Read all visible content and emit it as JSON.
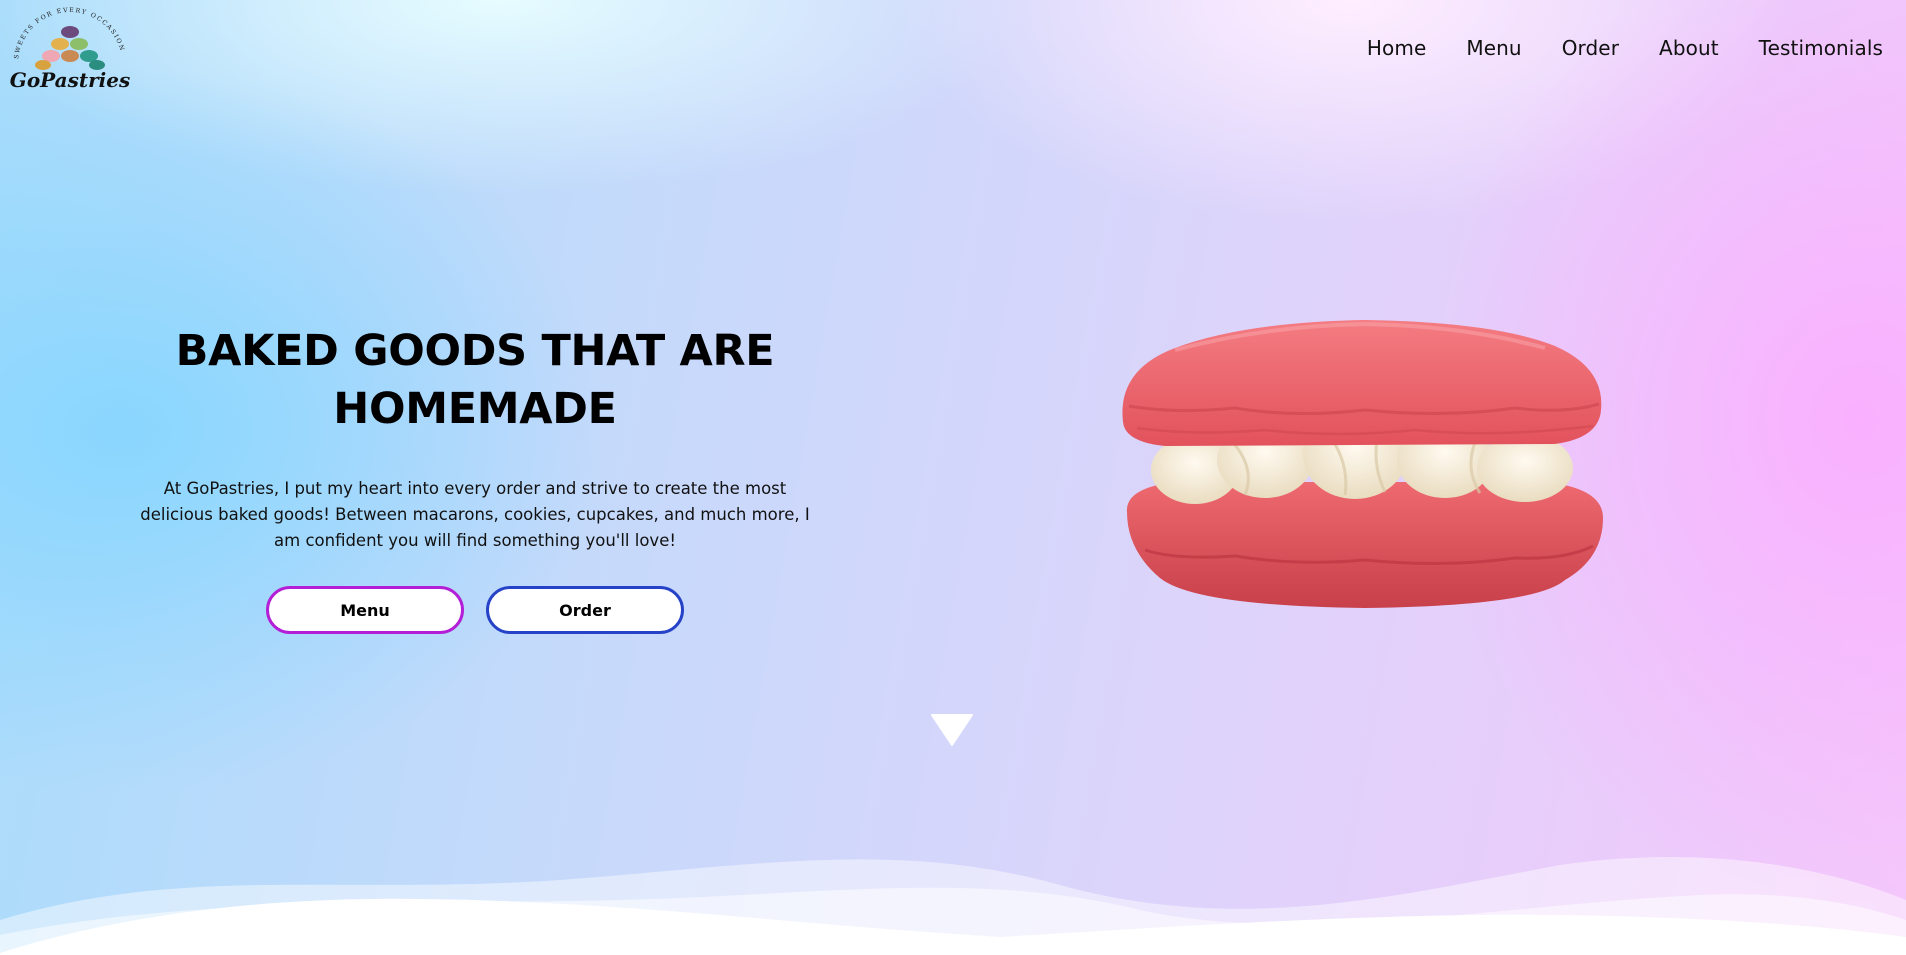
{
  "brand": {
    "name": "GoPastries",
    "tagline": "SWEETS FOR EVERY OCCASION"
  },
  "nav": {
    "items": [
      {
        "label": "Home"
      },
      {
        "label": "Menu"
      },
      {
        "label": "Order"
      },
      {
        "label": "About"
      },
      {
        "label": "Testimonials"
      }
    ]
  },
  "hero": {
    "title_line1": "BAKED GOODS THAT ARE",
    "title_line2": "HOMEMADE",
    "description": "At GoPastries, I put my heart into every order and strive to create the most delicious baked goods! Between macarons, cookies, cupcakes, and much more, I am confident you will find something you'll love!",
    "menu_button": "Menu",
    "order_button": "Order"
  },
  "icons": {
    "scroll": "chevron-down-triangle-icon"
  },
  "colors": {
    "menu_button_border": "#b21fd6",
    "order_button_border": "#2643c8",
    "macaron_shell": "#ef5e66",
    "macaron_filling": "#f6ecd8"
  }
}
